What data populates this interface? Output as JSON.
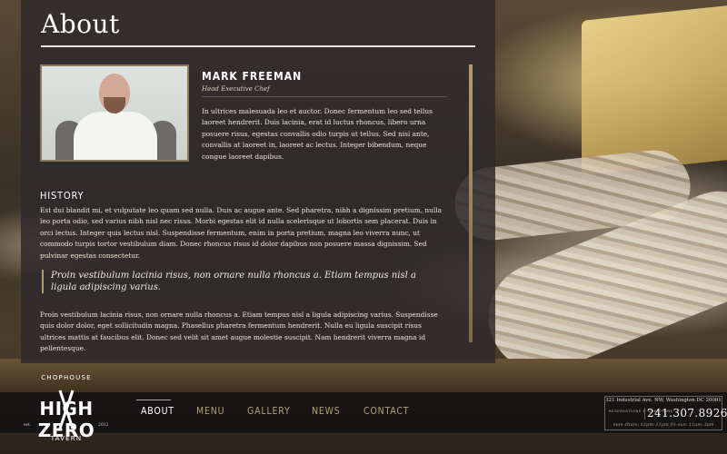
{
  "page": {
    "title": "About"
  },
  "chef": {
    "name": "MARK FREEMAN",
    "role": "Head Executive Chef",
    "bio": "In ultrices malesuada leo et auctor. Donec fermentum leo sed tellus laoreet hendrerit. Duis lacinia, erat id luctus rhoncus, libero urna posuere risus, egestas convallis odio turpis ut tellus. Sed nisi ante, convallis at laoreet in, laoreet ac lectus. Integer bibendum, neque congue laoreet dapibus."
  },
  "history": {
    "heading": "HISTORY",
    "paragraph": "Est dui blandit mi, et vulputate leo quam sed nulla. Duis ac augue ante. Sed pharetra, nibh a dignissim pretium, nulla leo porta odio, sed varius nibh nisl nec risus. Morbi egestas elit id nulla scelerisque ut lobortis sem placerat. Duis in orci lectus. Integer quis lectus nisl. Suspendisse fermentum, enim in porta pretium, magna leo viverra nunc, ut commodo turpis tortor vestibulum diam. Donec rhoncus risus id dolor dapibus non posuere massa dignissim. Sed pulvinar egestas consectetur.",
    "quote": "Proin vestibulum lacinia risus, non ornare nulla rhoncus a. Etiam tempus nisl a ligula adipiscing varius.",
    "paragraph2": "Proin vestibulum lacinia risus, non ornare nulla rhoncus a. Etiam tempus nisl a ligula adipiscing varius. Suspendisse quis dolor dolor, eget sollicitudin magna. Phasellus pharetra fermentum hendrerit. Nulla eu ligula suscipit risus ultrices mattis at faucibus elit. Donec sed velit sit amet augue molestie suscipit. Nam hendrerit viverra magna id pellentesque."
  },
  "logo": {
    "top_text": "CHOPHOUSE",
    "main_text": "HIGH ZERO",
    "est_text": "est.",
    "year_text": "2012",
    "bottom_text": "TAVERN"
  },
  "nav": {
    "items": [
      "ABOUT",
      "MENU",
      "GALLERY",
      "NEWS",
      "CONTACT"
    ],
    "active": "ABOUT"
  },
  "contact": {
    "address": "321 Industrial Ave. NW, Washington DC 20001",
    "reservations_label": "RESERVATIONS & QUESTIONS",
    "phone": "241.307.8926",
    "hours": "mon–thurs: 12pm–11pm  fri–sun: 11am–3am"
  },
  "colors": {
    "accent_gold": "#b89f70",
    "panel": "#2f2a2c",
    "footer": "#141212"
  },
  "icons": {
    "logo_knives": "crossed-knives-icon"
  }
}
